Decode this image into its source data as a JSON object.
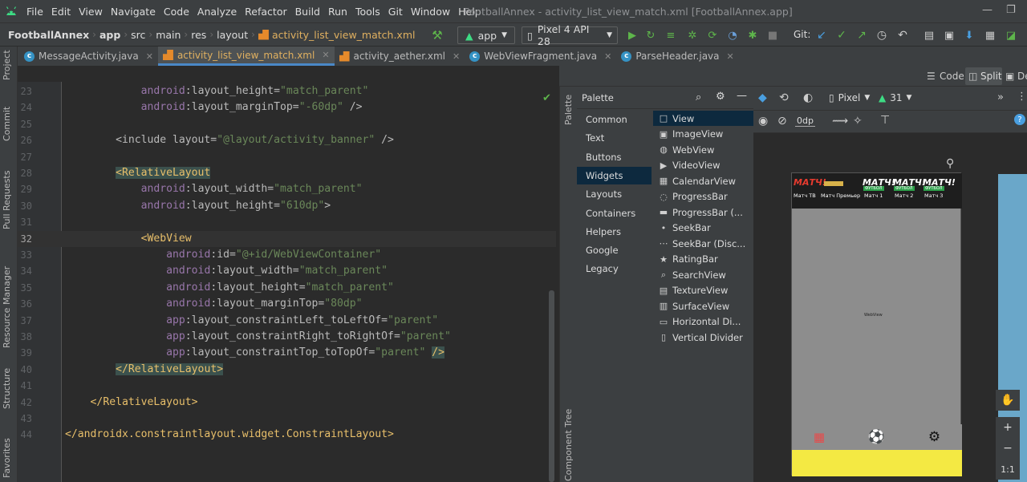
{
  "menu": [
    "File",
    "Edit",
    "View",
    "Navigate",
    "Code",
    "Analyze",
    "Refactor",
    "Build",
    "Run",
    "Tools",
    "Git",
    "Window",
    "Help"
  ],
  "window_title": "FootballAnnex - activity_list_view_match.xml [FootballAnnex.app]",
  "breadcrumbs": [
    "FootballAnnex",
    "app",
    "src",
    "main",
    "res",
    "layout",
    "activity_list_view_match.xml"
  ],
  "run_config": "app",
  "device": "Pixel 4 API 28",
  "git_label": "Git:",
  "tabs": [
    {
      "label": "MessageActivity.java",
      "type": "java",
      "active": false
    },
    {
      "label": "activity_list_view_match.xml",
      "type": "xml",
      "active": true
    },
    {
      "label": "activity_aether.xml",
      "type": "xml",
      "active": false
    },
    {
      "label": "WebViewFragment.java",
      "type": "java",
      "active": false
    },
    {
      "label": "ParseHeader.java",
      "type": "java",
      "active": false
    }
  ],
  "left_tools": [
    "Project",
    "Commit",
    "Pull Requests",
    "Resource Manager",
    "Structure",
    "Favorites"
  ],
  "right_tools": [
    "Palette",
    "Component Tree"
  ],
  "view_modes": [
    "Code",
    "Split",
    "De"
  ],
  "code_lines": [
    {
      "n": "23",
      "tokens": [
        [
          "at",
          "            "
        ],
        [
          "ns",
          "android"
        ],
        [
          "at",
          ":layout_height="
        ],
        [
          "st",
          "\"match_parent\""
        ]
      ]
    },
    {
      "n": "24",
      "tokens": [
        [
          "at",
          "            "
        ],
        [
          "ns",
          "android"
        ],
        [
          "at",
          ":layout_marginTop="
        ],
        [
          "st",
          "\"-60dp\""
        ],
        [
          "at",
          " />"
        ]
      ]
    },
    {
      "n": "25",
      "tokens": [
        [
          "at",
          ""
        ]
      ]
    },
    {
      "n": "26",
      "tokens": [
        [
          "at",
          "        <include layout="
        ],
        [
          "st",
          "\"@layout/activity_banner\""
        ],
        [
          "at",
          " />"
        ]
      ]
    },
    {
      "n": "27",
      "tokens": [
        [
          "at",
          ""
        ]
      ]
    },
    {
      "n": "28",
      "tokens": [
        [
          "at",
          "        "
        ],
        [
          "tgh",
          "<RelativeLayout"
        ]
      ]
    },
    {
      "n": "29",
      "tokens": [
        [
          "at",
          "            "
        ],
        [
          "ns",
          "android"
        ],
        [
          "at",
          ":layout_width="
        ],
        [
          "st",
          "\"match_parent\""
        ]
      ]
    },
    {
      "n": "30",
      "tokens": [
        [
          "at",
          "            "
        ],
        [
          "ns",
          "android"
        ],
        [
          "at",
          ":layout_height="
        ],
        [
          "st",
          "\"610dp\""
        ],
        [
          "at",
          ">"
        ]
      ]
    },
    {
      "n": "31",
      "tokens": [
        [
          "at",
          ""
        ]
      ]
    },
    {
      "n": "32",
      "tokens": [
        [
          "at",
          "            "
        ],
        [
          "tg",
          "<WebView"
        ]
      ],
      "current": true
    },
    {
      "n": "33",
      "tokens": [
        [
          "at",
          "                "
        ],
        [
          "ns",
          "android"
        ],
        [
          "at",
          ":id="
        ],
        [
          "st",
          "\"@+id/WebViewContainer\""
        ]
      ]
    },
    {
      "n": "34",
      "tokens": [
        [
          "at",
          "                "
        ],
        [
          "ns",
          "android"
        ],
        [
          "at",
          ":layout_width="
        ],
        [
          "st",
          "\"match_parent\""
        ]
      ]
    },
    {
      "n": "35",
      "tokens": [
        [
          "at",
          "                "
        ],
        [
          "ns",
          "android"
        ],
        [
          "at",
          ":layout_height="
        ],
        [
          "st",
          "\"match_parent\""
        ]
      ]
    },
    {
      "n": "36",
      "tokens": [
        [
          "at",
          "                "
        ],
        [
          "ns",
          "android"
        ],
        [
          "at",
          ":layout_marginTop="
        ],
        [
          "st",
          "\"80dp\""
        ]
      ]
    },
    {
      "n": "37",
      "tokens": [
        [
          "at",
          "                "
        ],
        [
          "ns",
          "app"
        ],
        [
          "at",
          ":layout_constraintLeft_toLeftOf="
        ],
        [
          "st",
          "\"parent\""
        ]
      ]
    },
    {
      "n": "38",
      "tokens": [
        [
          "at",
          "                "
        ],
        [
          "ns",
          "app"
        ],
        [
          "at",
          ":layout_constraintRight_toRightOf="
        ],
        [
          "st",
          "\"parent\""
        ]
      ]
    },
    {
      "n": "39",
      "tokens": [
        [
          "at",
          "                "
        ],
        [
          "ns",
          "app"
        ],
        [
          "at",
          ":layout_constraintTop_toTopOf="
        ],
        [
          "st",
          "\"parent\""
        ],
        [
          "at",
          " "
        ],
        [
          "tgh",
          "/>"
        ]
      ]
    },
    {
      "n": "40",
      "tokens": [
        [
          "at",
          "        "
        ],
        [
          "tgh",
          "</RelativeLayout>"
        ]
      ]
    },
    {
      "n": "41",
      "tokens": [
        [
          "at",
          ""
        ]
      ]
    },
    {
      "n": "42",
      "tokens": [
        [
          "at",
          "    "
        ],
        [
          "tg",
          "</RelativeLayout>"
        ]
      ]
    },
    {
      "n": "43",
      "tokens": [
        [
          "at",
          ""
        ]
      ]
    },
    {
      "n": "44",
      "tokens": [
        [
          "tg",
          "</androidx.constraintlayout.widget.ConstraintLayout>"
        ]
      ]
    }
  ],
  "palette": {
    "title": "Palette",
    "categories": [
      "Common",
      "Text",
      "Buttons",
      "Widgets",
      "Layouts",
      "Containers",
      "Helpers",
      "Google",
      "Legacy"
    ],
    "selected_category": "Widgets",
    "widgets": [
      {
        "label": "View",
        "icon": "□"
      },
      {
        "label": "ImageView",
        "icon": "▣"
      },
      {
        "label": "WebView",
        "icon": "◍"
      },
      {
        "label": "VideoView",
        "icon": "▶"
      },
      {
        "label": "CalendarView",
        "icon": "▦"
      },
      {
        "label": "ProgressBar",
        "icon": "◌"
      },
      {
        "label": "ProgressBar (...",
        "icon": "▬"
      },
      {
        "label": "SeekBar",
        "icon": "•"
      },
      {
        "label": "SeekBar (Disc...",
        "icon": "⋯"
      },
      {
        "label": "RatingBar",
        "icon": "★"
      },
      {
        "label": "SearchView",
        "icon": "⌕"
      },
      {
        "label": "TextureView",
        "icon": "▤"
      },
      {
        "label": "SurfaceView",
        "icon": "▥"
      },
      {
        "label": "Horizontal Di...",
        "icon": "▭"
      },
      {
        "label": "Vertical Divider",
        "icon": "▯"
      }
    ]
  },
  "design_toolbar": {
    "device": "Pixel",
    "api": "31",
    "margin": "0dp"
  },
  "preview": {
    "channels": [
      "Матч ТВ",
      "Матч Премьер",
      "Матч 1",
      "Матч 2",
      "Матч 3"
    ],
    "logo_text": "МАТЧ!",
    "badge_text": "ФУТБОЛ",
    "webview_label": "WebView",
    "colors": {
      "bottom_bar": "#f4e943",
      "content": "#8d8d8d",
      "top": "#1e1e1e",
      "accent": "#e73b2f"
    }
  },
  "zoom": [
    "+",
    "−",
    "1:1"
  ]
}
